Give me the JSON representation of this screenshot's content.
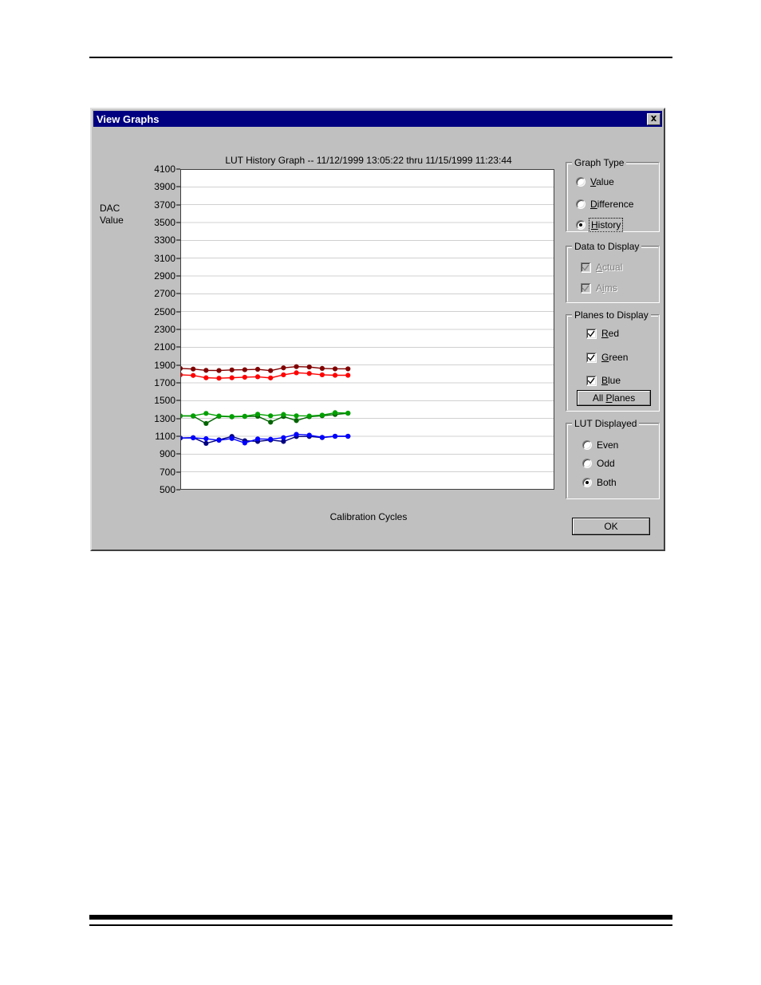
{
  "window": {
    "title": "View Graphs",
    "close_icon": "close-icon"
  },
  "chart_panel": {
    "title": "LUT History Graph -- 11/12/1999 13:05:22   thru   11/15/1999 11:23:44",
    "ylabel_line1": "DAC",
    "ylabel_line2": "Value",
    "xlabel": "Calibration Cycles"
  },
  "graph_type": {
    "legend": "Graph Type",
    "options": [
      {
        "label": "Value",
        "accel": "V",
        "selected": false
      },
      {
        "label": "Difference",
        "accel": "D",
        "selected": false
      },
      {
        "label": "History",
        "accel": "H",
        "selected": true
      }
    ]
  },
  "data_to_display": {
    "legend": "Data to Display",
    "options": [
      {
        "label": "Actual",
        "accel": "A",
        "checked": true,
        "disabled": true
      },
      {
        "label": "Aims",
        "accel": "i",
        "checked": true,
        "disabled": true
      }
    ]
  },
  "planes_to_display": {
    "legend": "Planes to Display",
    "options": [
      {
        "label": "Red",
        "accel": "R",
        "checked": true
      },
      {
        "label": "Green",
        "accel": "G",
        "checked": true
      },
      {
        "label": "Blue",
        "accel": "B",
        "checked": true
      }
    ],
    "all_planes_label": "All Planes"
  },
  "lut_displayed": {
    "legend": "LUT Displayed",
    "options": [
      {
        "label": "Even",
        "selected": false
      },
      {
        "label": "Odd",
        "selected": false
      },
      {
        "label": "Both",
        "selected": true
      }
    ]
  },
  "footer": {
    "ok_label": "OK"
  },
  "chart_data": {
    "type": "line",
    "title": "LUT History Graph -- 11/12/1999 13:05:22   thru   11/15/1999 11:23:44",
    "xlabel": "Calibration Cycles",
    "ylabel": "DAC Value",
    "grid": true,
    "legend_position": "none",
    "ylim": [
      500,
      4100
    ],
    "yticks": [
      4100,
      3900,
      3700,
      3500,
      3300,
      3100,
      2900,
      2700,
      2500,
      2300,
      2100,
      1900,
      1700,
      1500,
      1300,
      1100,
      900,
      700,
      500
    ],
    "xticks": [],
    "xlim": [
      0,
      29
    ],
    "x": [
      0,
      1,
      2,
      3,
      4,
      5,
      6,
      7,
      8,
      9,
      10,
      11,
      12,
      13
    ],
    "series": [
      {
        "name": "Red Actual",
        "color": "#800000",
        "values": [
          1862,
          1855,
          1840,
          1838,
          1845,
          1847,
          1852,
          1837,
          1868,
          1882,
          1878,
          1862,
          1857,
          1857
        ]
      },
      {
        "name": "Red Aim",
        "color": "#ff0000",
        "values": [
          1790,
          1783,
          1757,
          1752,
          1757,
          1763,
          1768,
          1755,
          1790,
          1813,
          1805,
          1790,
          1785,
          1785
        ]
      },
      {
        "name": "Green Actual",
        "color": "#006400",
        "values": [
          1328,
          1327,
          1244,
          1325,
          1318,
          1322,
          1325,
          1258,
          1322,
          1276,
          1320,
          1330,
          1345,
          1358
        ]
      },
      {
        "name": "Green Aim",
        "color": "#00a000",
        "values": [
          1330,
          1330,
          1357,
          1328,
          1322,
          1325,
          1348,
          1330,
          1345,
          1330,
          1328,
          1338,
          1365,
          1360
        ]
      },
      {
        "name": "Blue Actual",
        "color": "#000080",
        "values": [
          1080,
          1085,
          1020,
          1060,
          1098,
          1050,
          1042,
          1058,
          1042,
          1097,
          1098,
          1085,
          1100,
          1100
        ]
      },
      {
        "name": "Blue Aim",
        "color": "#0000ff",
        "values": [
          1080,
          1082,
          1073,
          1055,
          1075,
          1025,
          1070,
          1067,
          1085,
          1122,
          1113,
          1088,
          1100,
          1100
        ]
      }
    ]
  }
}
